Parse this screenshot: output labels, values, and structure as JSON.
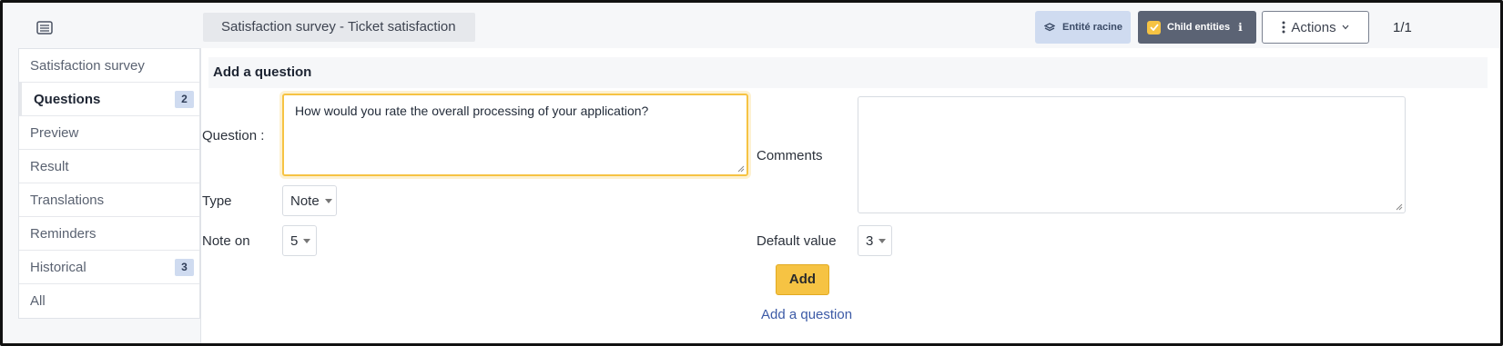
{
  "header": {
    "breadcrumb": "Satisfaction survey - Ticket satisfaction",
    "entity_label": "Entité racine",
    "child_entities_label": "Child entities",
    "info_icon": "ℹ",
    "actions_label": "Actions",
    "pager": "1/1"
  },
  "sidebar": {
    "items": [
      {
        "label": "Satisfaction survey"
      },
      {
        "label": "Questions",
        "count": "2",
        "active": true
      },
      {
        "label": "Preview"
      },
      {
        "label": "Result"
      },
      {
        "label": "Translations"
      },
      {
        "label": "Reminders"
      },
      {
        "label": "Historical",
        "count": "3"
      },
      {
        "label": "All"
      }
    ]
  },
  "form": {
    "title": "Add a question",
    "question_label": "Question :",
    "question_value": "How would you rate the overall processing of your application?",
    "comments_label": "Comments",
    "comments_value": "",
    "type_label": "Type",
    "type_value": "Note",
    "note_on_label": "Note on",
    "note_on_value": "5",
    "default_value_label": "Default value",
    "default_value": "3",
    "add_button": "Add",
    "add_question_link": "Add a question"
  },
  "colors": {
    "accent": "#f6c343",
    "badge_bg": "#cfdbf0",
    "child_btn_bg": "#5b6374",
    "link": "#3c5aa6"
  },
  "icons": {
    "list_toggle": "list-icon",
    "entity": "layers-icon",
    "child": "checkbox-checked-icon",
    "actions": "kebab-vertical-icon"
  }
}
